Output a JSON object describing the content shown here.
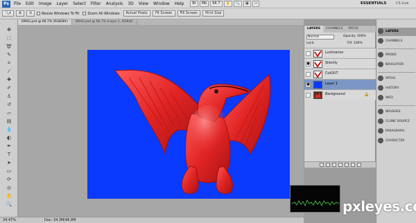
{
  "app": {
    "logo": "Ps",
    "menus": [
      "File",
      "Edit",
      "Image",
      "Layer",
      "Select",
      "Filter",
      "Analysis",
      "3D",
      "View",
      "Window",
      "Help"
    ],
    "zoom_menu_value": "66.7",
    "workspace": "ESSENTIALS",
    "cs_live": "CS Live"
  },
  "options_bar": {
    "checks": [
      "Resize Windows To Fit",
      "Zoom All Windows"
    ],
    "buttons": [
      "Actual Pixels",
      "Fit Screen",
      "Fill Screen",
      "Print Size"
    ]
  },
  "doc_tabs": [
    {
      "label": "DRAG.psd @ 66.7% (RGB/8#)",
      "active": true
    },
    {
      "label": "DRAG.psd @ 66.7% (Layer 1, RGB/8)",
      "active": false
    }
  ],
  "status": {
    "zoom": "34.47%",
    "doc_size": "Doc: 34.3M/96.8M"
  },
  "layers_panel": {
    "tabs": [
      "LAYERS",
      "CHANNELS",
      "PATHS"
    ],
    "blend_mode": "Normal",
    "opacity_label": "Opacity: 100%",
    "lock_label": "Lock:",
    "fill_label": "Fill: 100%",
    "layers": [
      {
        "name": "Luminance",
        "visible": false,
        "selected": false,
        "thumb": "adjust"
      },
      {
        "name": "Silently",
        "visible": true,
        "selected": false,
        "thumb": "adjust"
      },
      {
        "name": "CutOUT",
        "visible": false,
        "selected": false,
        "thumb": "adjust"
      },
      {
        "name": "Layer 1",
        "visible": true,
        "selected": true,
        "thumb": "blue"
      },
      {
        "name": "Background",
        "visible": false,
        "selected": false,
        "thumb": "photo"
      }
    ]
  },
  "dock": {
    "items": [
      "LAYERS",
      "CHANNELS",
      "MASKS",
      "NAVIGATOR",
      "PATHS",
      "HISTORY",
      "INFO",
      "BRUSHES",
      "CLONE SOURCE",
      "PARAGRAPH",
      "CHARACTER"
    ],
    "active": "LAYERS"
  },
  "colors": {
    "canvas_blue": "#0b3aff",
    "dino_red": "#e22a2a",
    "selection": "#7c97c6"
  },
  "watermark": "pxleyes.com"
}
